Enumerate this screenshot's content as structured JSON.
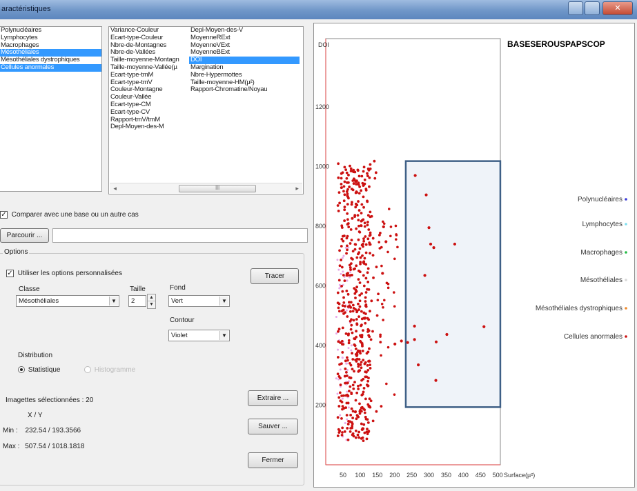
{
  "window": {
    "title": "aractéristiques"
  },
  "class_list": {
    "items": [
      {
        "label": "Polynucléaires",
        "selected": false
      },
      {
        "label": "Lymphocytes",
        "selected": false
      },
      {
        "label": "Macrophages",
        "selected": false
      },
      {
        "label": "Mésothéliales",
        "selected": true
      },
      {
        "label": "Mésothéliales dystrophiques",
        "selected": false
      },
      {
        "label": "Cellules anormales",
        "selected": true
      }
    ]
  },
  "variable_list": {
    "col1": [
      {
        "label": "Variance-Couleur",
        "selected": false
      },
      {
        "label": "Ecart-type-Couleur",
        "selected": false
      },
      {
        "label": "Nbre-de-Montagnes",
        "selected": false
      },
      {
        "label": "Nbre-de-Vallées",
        "selected": false
      },
      {
        "label": "Taille-moyenne-Montagn",
        "selected": false
      },
      {
        "label": "Taille-moyenne-Vallée(µ",
        "selected": false
      },
      {
        "label": "Ecart-type-tmM",
        "selected": false
      },
      {
        "label": "Ecart-type-tmV",
        "selected": false
      },
      {
        "label": "Couleur-Montagne",
        "selected": false
      },
      {
        "label": "Couleur-Vallée",
        "selected": false
      },
      {
        "label": "Ecart-type-CM",
        "selected": false
      },
      {
        "label": "Ecart-type-CV",
        "selected": false
      },
      {
        "label": "Rapport-tmV/tmM",
        "selected": false
      },
      {
        "label": "Depl-Moyen-des-M",
        "selected": false
      }
    ],
    "col2": [
      {
        "label": "Depl-Moyen-des-V",
        "selected": false
      },
      {
        "label": "MoyenneRExt",
        "selected": false
      },
      {
        "label": "MoyenneVExt",
        "selected": false
      },
      {
        "label": "MoyenneBExt",
        "selected": false
      },
      {
        "label": "DOI",
        "selected": true
      },
      {
        "label": "Margination",
        "selected": false
      },
      {
        "label": "Nbre-Hypermottes",
        "selected": false
      },
      {
        "label": "Taille-moyenne-HM(µ²)",
        "selected": false
      },
      {
        "label": "Rapport-Chromatine/Noyau",
        "selected": false
      }
    ],
    "scroll_left": "◂",
    "scroll_right": "▸",
    "scroll_grip": "III"
  },
  "compare": {
    "checkbox_label": "Comparer avec une base ou un autre cas",
    "checked": true,
    "browse_label": "Parcourir ...",
    "path_value": ""
  },
  "options": {
    "group_title": "Options",
    "use_custom_label": "Utiliser les options personnalisées",
    "use_custom_checked": true,
    "class_label": "Classe",
    "class_value": "Mésothéliales",
    "size_label": "Taille",
    "size_value": "2",
    "fill_label": "Fond",
    "fill_value": "Vert",
    "outline_label": "Contour",
    "outline_value": "Violet",
    "distribution_label": "Distribution",
    "dist_statistic": "Statistique",
    "dist_histogram": "Histogramme",
    "trace_button": "Tracer"
  },
  "selection": {
    "count_label": "Imagettes sélectionnées : 20",
    "xy_header": "X / Y",
    "min_label": "Min :",
    "min_value": "232.54 / 193.3566",
    "max_label": "Max :",
    "max_value": "507.54 / 1018.1818"
  },
  "buttons": {
    "extract": "Extraire ...",
    "save": "Sauver ...",
    "close": "Fermer"
  },
  "chart_data": {
    "type": "scatter",
    "title": "BASESEROUSPAPSCOP",
    "xlabel": "Surface(µ²)",
    "ylabel": "DOI",
    "x_ticks": [
      50,
      100,
      150,
      200,
      250,
      300,
      350,
      400,
      450,
      500
    ],
    "y_ticks": [
      200,
      400,
      600,
      800,
      1000,
      1200
    ],
    "xlim": [
      0,
      520
    ],
    "ylim": [
      50,
      1400
    ],
    "colors": {
      "Polynucléaires": "#3a3ad8",
      "Lymphocytes": "#7fe0f0",
      "Macrophages": "#22bb44",
      "Mésothéliales": "#d8d8d8",
      "Mésothéliales dystrophiques": "#f08a2a",
      "Cellules anormales": "#cc1111"
    },
    "legend": [
      "Polynucléaires",
      "Lymphocytes",
      "Macrophages",
      "Mésothéliales",
      "Mésothéliales dystrophiques",
      "Cellules anormales"
    ],
    "series": [
      {
        "name": "Cellules anormales",
        "points": [
          [
            260,
            970
          ],
          [
            292,
            905
          ],
          [
            300,
            795
          ],
          [
            314,
            728
          ],
          [
            305,
            740
          ],
          [
            375,
            740
          ],
          [
            288,
            635
          ],
          [
            258,
            465
          ],
          [
            258,
            420
          ],
          [
            321,
            412
          ],
          [
            352,
            437
          ],
          [
            460,
            463
          ],
          [
            320,
            283
          ],
          [
            269,
            335
          ],
          [
            201,
            405
          ],
          [
            220,
            415
          ],
          [
            238,
            410
          ],
          [
            168,
            798
          ],
          [
            175,
            748
          ],
          [
            165,
            642
          ]
        ]
      }
    ],
    "highlight_box": {
      "x": [
        232.54,
        507.54
      ],
      "y": [
        193.3566,
        1018.1818
      ]
    }
  }
}
